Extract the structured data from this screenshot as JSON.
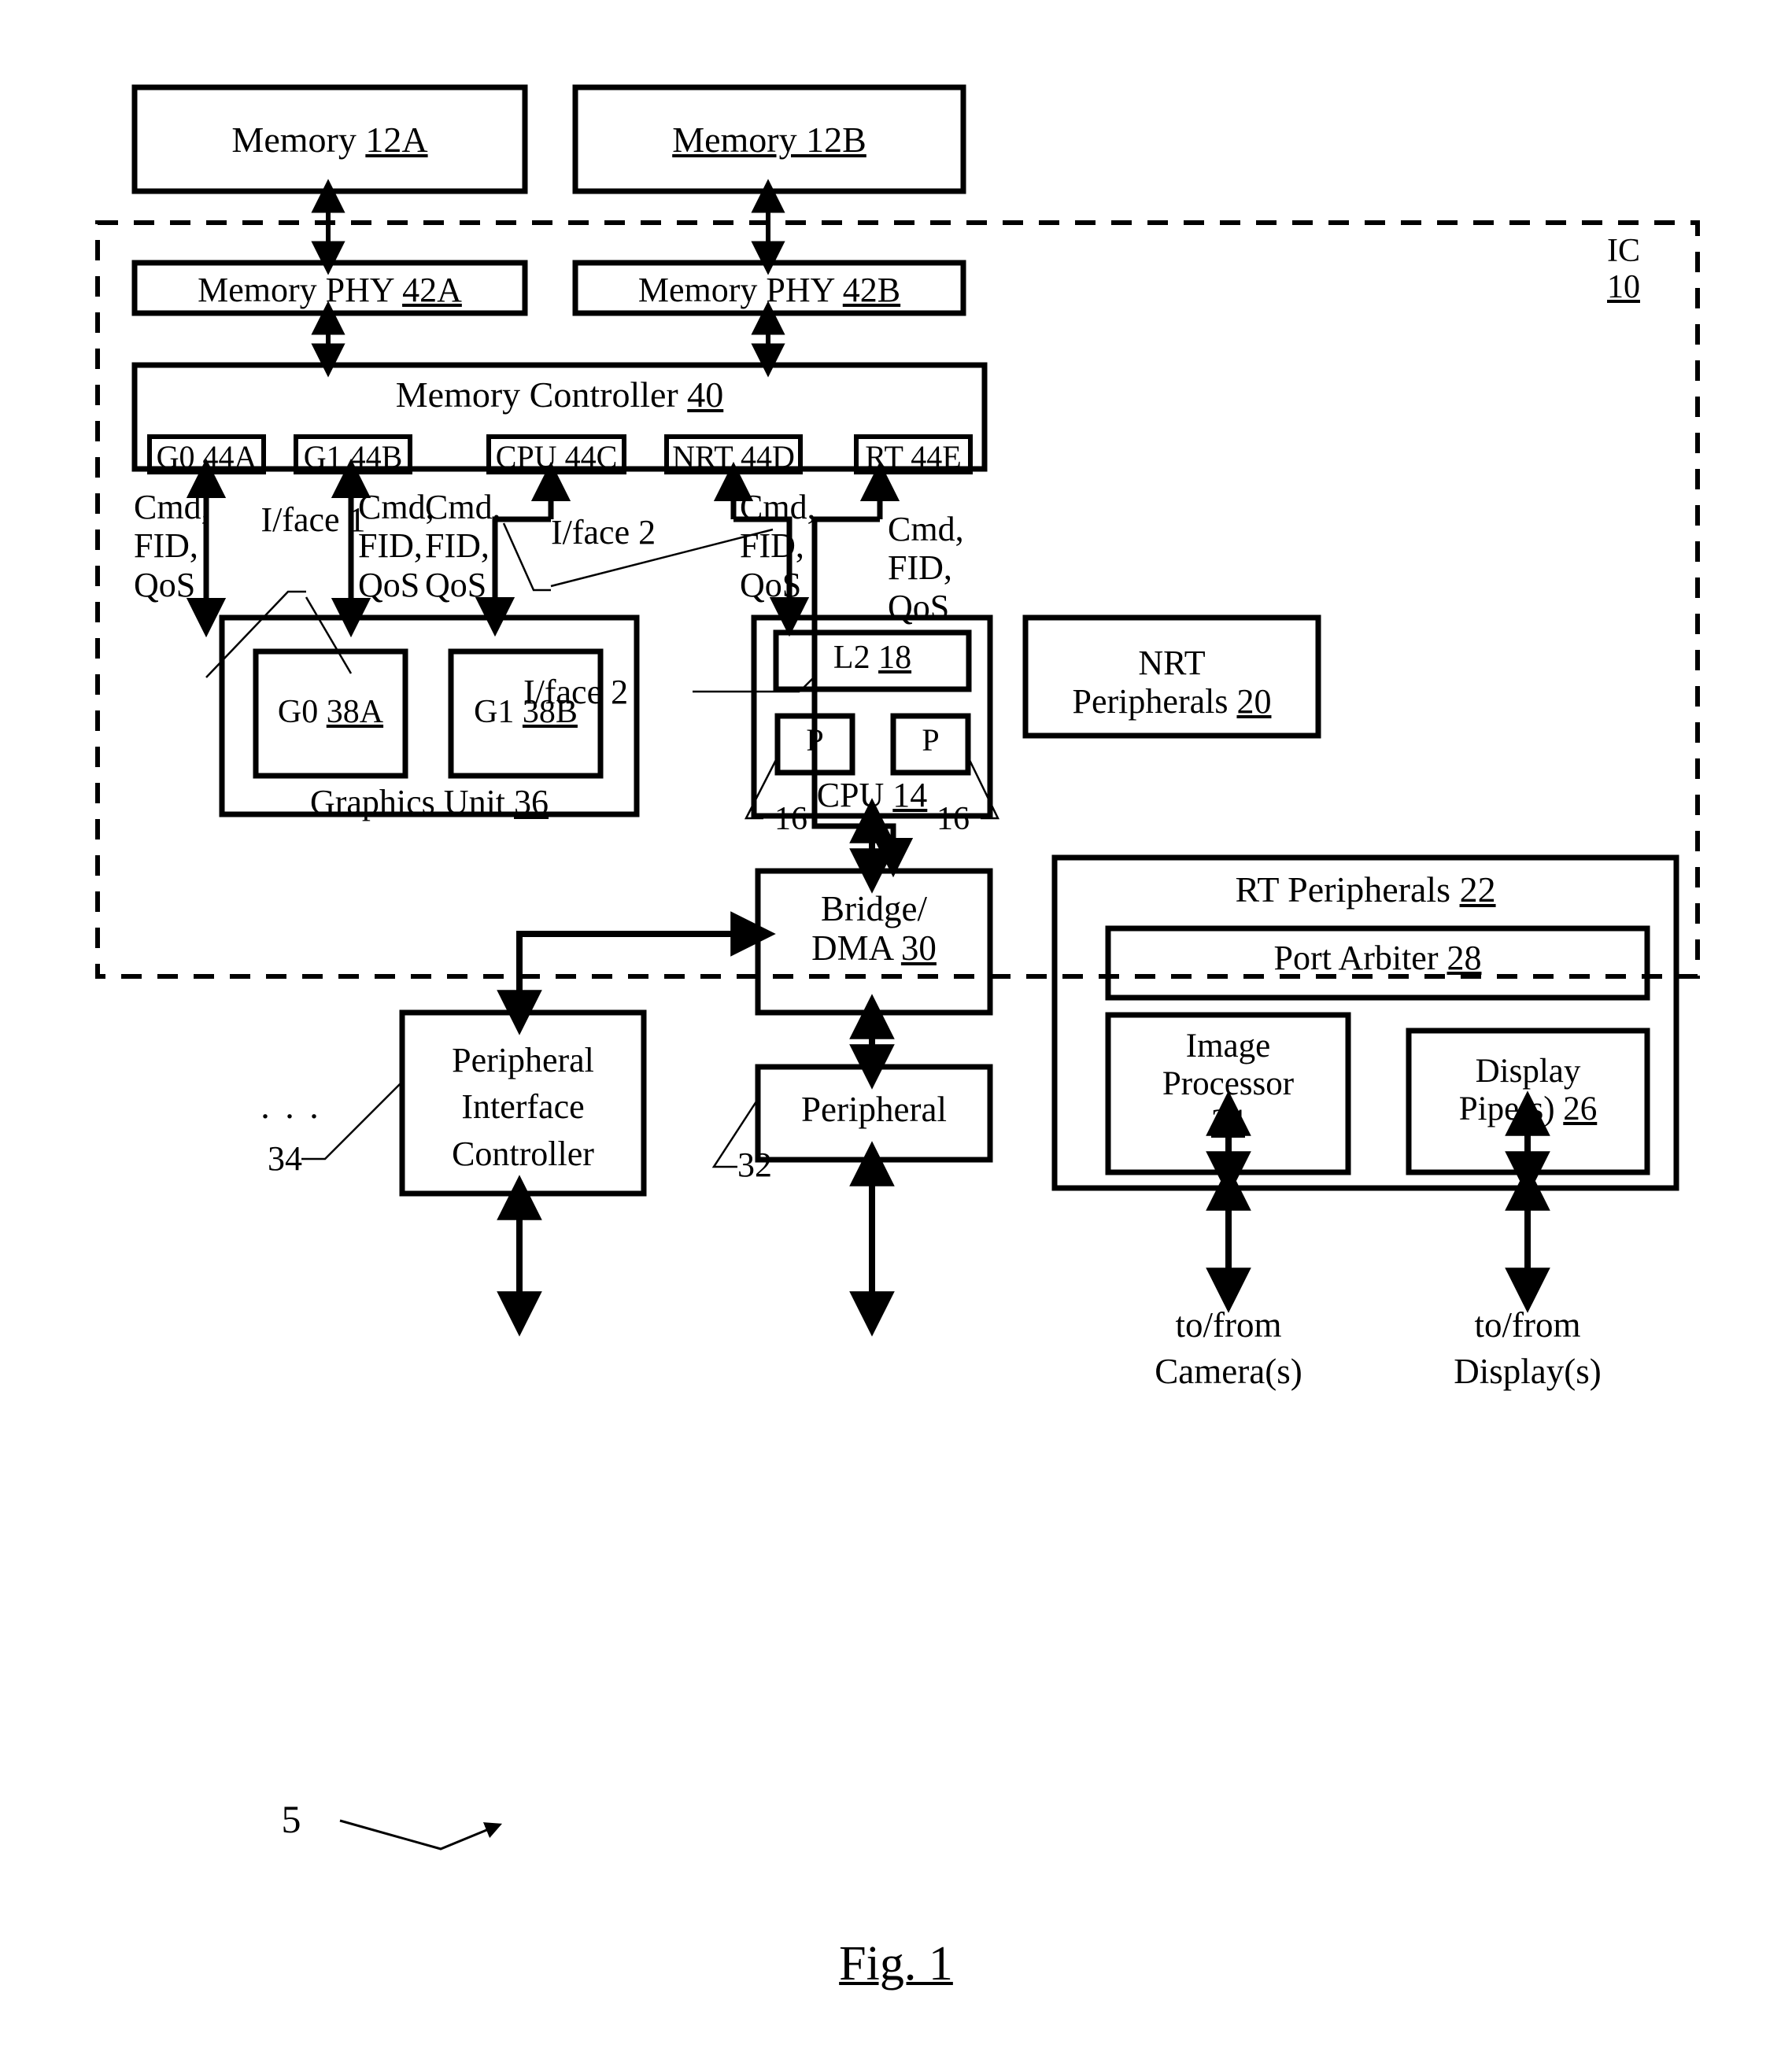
{
  "figure": {
    "caption": "Fig. 1",
    "ref_numeral": "5",
    "chip_label_line1": "IC",
    "chip_label_line2": "10"
  },
  "memories": [
    {
      "name": "Memory",
      "ref": "12A",
      "underline": "ref-only"
    },
    {
      "name": "Memory 12B",
      "ref": "",
      "underline": "full"
    }
  ],
  "phys": [
    {
      "name": "Memory PHY",
      "ref": "42A"
    },
    {
      "name": "Memory PHY",
      "ref": "42B"
    }
  ],
  "memory_controller": {
    "name": "Memory Controller",
    "ref": "40",
    "ports": [
      {
        "name": "G0",
        "ref": "44A"
      },
      {
        "name": "G1",
        "ref": "44B"
      },
      {
        "name": "CPU",
        "ref": "44C"
      },
      {
        "name": "NRT",
        "ref": "44D"
      },
      {
        "name": "RT",
        "ref": "44E"
      }
    ]
  },
  "signal_labels": [
    {
      "lines": [
        "Cmd,",
        "FID,",
        "QoS"
      ]
    },
    {
      "lines": [
        "Cmd,",
        "FID,",
        "QoS"
      ]
    },
    {
      "lines": [
        "Cmd,",
        "FID,",
        "QoS"
      ]
    },
    {
      "lines": [
        "Cmd,",
        "FID,",
        "QoS"
      ]
    },
    {
      "lines": [
        "Cmd,",
        "FID,",
        "QoS"
      ]
    }
  ],
  "interfaces": [
    {
      "label": "I/face 1"
    },
    {
      "label": "I/face 2"
    },
    {
      "label": "I/face 2"
    }
  ],
  "graphics_unit": {
    "name": "Graphics Unit",
    "ref": "36",
    "engines": [
      {
        "name": "G0",
        "ref": "38A"
      },
      {
        "name": "G1",
        "ref": "38B"
      }
    ]
  },
  "cpu_block": {
    "l2": {
      "name": "L2",
      "ref": "18"
    },
    "cores": [
      {
        "name": "P"
      },
      {
        "name": "P"
      }
    ],
    "name": "CPU",
    "ref": "14",
    "core_refs": [
      "16",
      "16"
    ]
  },
  "nrt_peripherals": {
    "line1": "NRT",
    "line2": "Peripherals",
    "ref": "20"
  },
  "rt_peripherals": {
    "name": "RT Peripherals",
    "ref": "22",
    "port_arbiter": {
      "name": "Port Arbiter",
      "ref": "28"
    },
    "image_processor": {
      "line1": "Image",
      "line2": "Processor",
      "ref": "24"
    },
    "display_pipes": {
      "line1": "Display",
      "line2": "Pipe(s)",
      "ref": "26"
    }
  },
  "bridge_dma": {
    "line1": "Bridge/",
    "line2": "DMA",
    "ref": "30"
  },
  "peripheral": {
    "name": "Peripheral",
    "ref": "32"
  },
  "peripheral_interface_controller": {
    "line1": "Peripheral",
    "line2": "Interface",
    "line3": "Controller",
    "ref": "34",
    "ellipsis": ". . ."
  },
  "external_connections": [
    {
      "line1": "to/from",
      "line2": "Camera(s)"
    },
    {
      "line1": "to/from",
      "line2": "Display(s)"
    }
  ]
}
